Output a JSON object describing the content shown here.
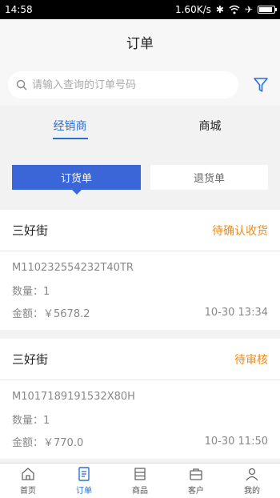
{
  "statusbar": {
    "time": "14:58",
    "speed": "1.60K/s",
    "battery_level": 0.9
  },
  "header": {
    "title": "订单"
  },
  "search": {
    "placeholder": "请输入查询的订单号码"
  },
  "tabs": [
    {
      "label": "经销商",
      "active": true
    },
    {
      "label": "商城",
      "active": false
    }
  ],
  "segment": {
    "active": "订货单",
    "inactive": "退货单"
  },
  "orders": [
    {
      "store": "三好街",
      "status": "待确认收货",
      "order_no": "M110232554232T40TR",
      "qty": "数量：1",
      "amount": "金额：￥5678.2",
      "time": "10-30 13:34"
    },
    {
      "store": "三好街",
      "status": "待审核",
      "order_no": "M1017189191532X80H",
      "qty": "数量：1",
      "amount": "金额：￥770.0",
      "time": "10-30 11:50"
    }
  ],
  "bottom_nav": [
    {
      "label": "首页",
      "icon": "home-icon",
      "active": false
    },
    {
      "label": "订单",
      "icon": "order-icon",
      "active": true
    },
    {
      "label": "商品",
      "icon": "goods-icon",
      "active": false
    },
    {
      "label": "客户",
      "icon": "customer-icon",
      "active": false
    },
    {
      "label": "我的",
      "icon": "profile-icon",
      "active": false
    }
  ],
  "colors": {
    "accent": "#2a6fd6",
    "button": "#3a66d8",
    "status": "#f08a1c"
  }
}
